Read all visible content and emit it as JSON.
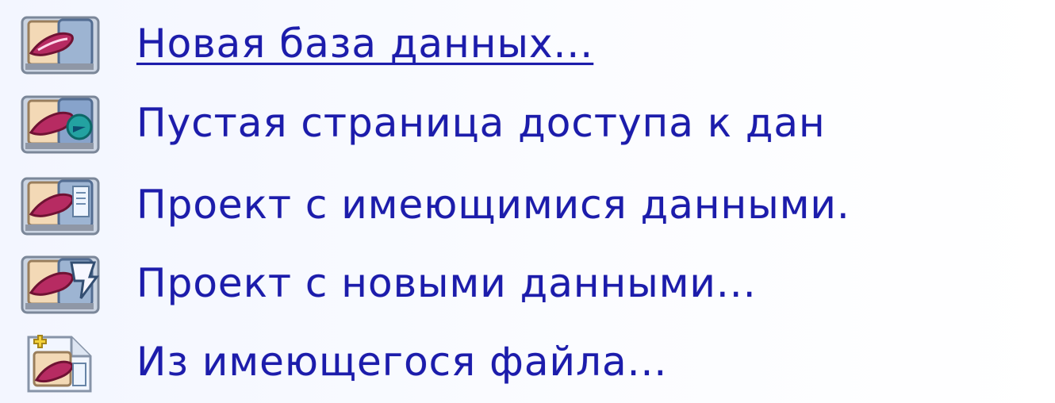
{
  "colors": {
    "link_text": "#1c1cab",
    "background": "#f7f9ff"
  },
  "items": [
    {
      "label": "Новая база данных...",
      "icon": "new-database-icon",
      "selected": true
    },
    {
      "label": "Пустая страница доступа к дан",
      "icon": "blank-data-access-page-icon",
      "selected": false
    },
    {
      "label": "Проект с имеющимися данными.",
      "icon": "project-existing-data-icon",
      "selected": false
    },
    {
      "label": "Проект с новыми данными...",
      "icon": "project-new-data-icon",
      "selected": false
    },
    {
      "label": "Из имеющегося файла...",
      "icon": "from-existing-file-icon",
      "selected": false
    }
  ]
}
